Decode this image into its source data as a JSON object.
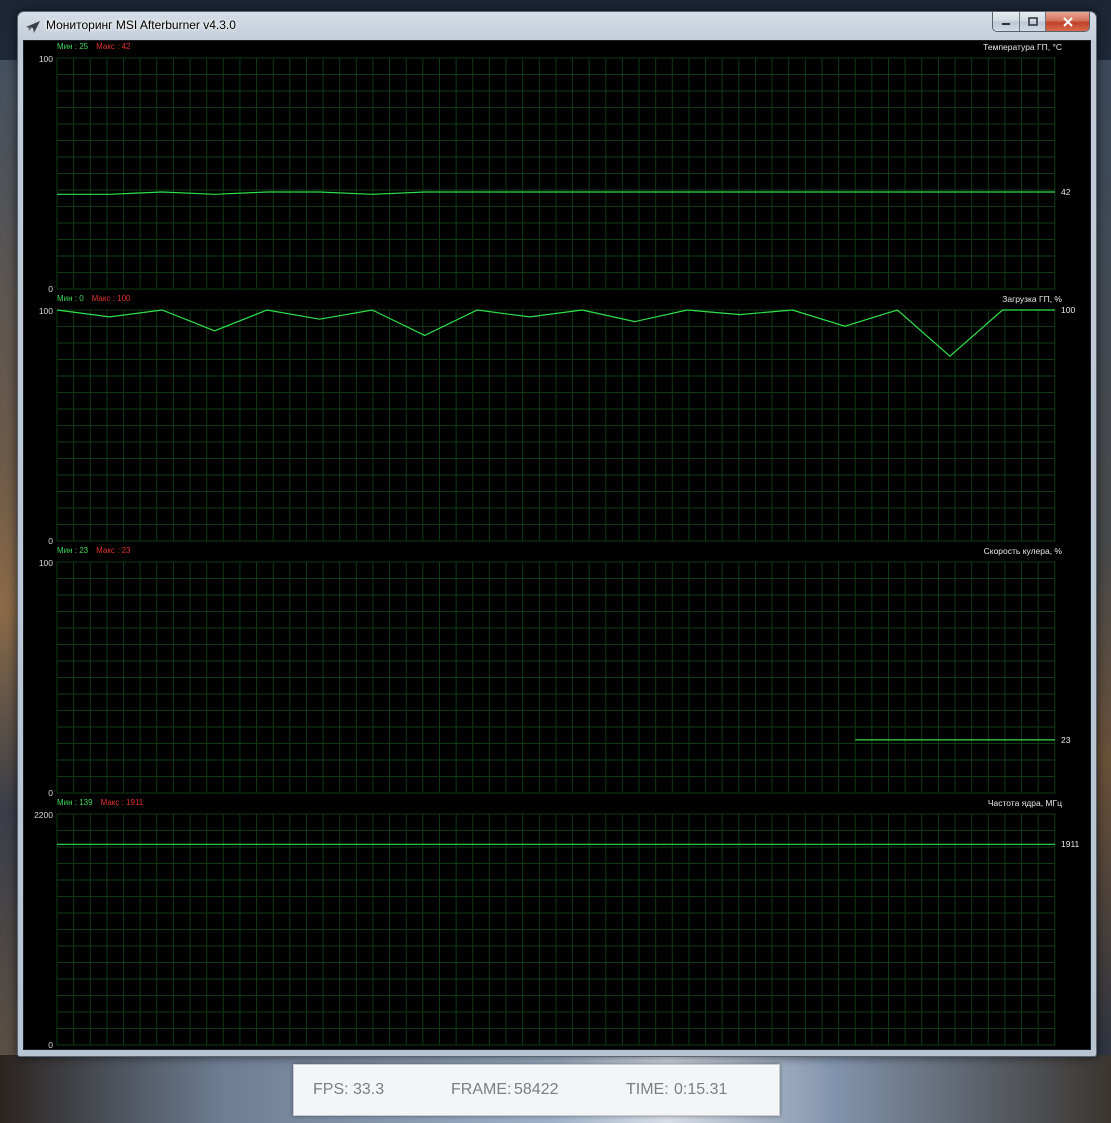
{
  "window": {
    "title": "Мониторинг MSI Afterburner v4.3.0",
    "icon": "afterburner-plane-icon",
    "controls": {
      "minimize": "minimize-icon",
      "maximize": "maximize-icon",
      "close": "close-icon"
    }
  },
  "panels": [
    {
      "id": "gpu-temp",
      "title": "Температура ГП, °C",
      "min_label": "Мин : 25",
      "max_label": "Макс : 42",
      "y_max_label": "100",
      "y_min_label": "0",
      "current_label": "42"
    },
    {
      "id": "gpu-load",
      "title": "Загрузка ГП, %",
      "min_label": "Мин : 0",
      "max_label": "Макс : 100",
      "y_max_label": "100",
      "y_min_label": "0",
      "current_label": "100"
    },
    {
      "id": "fan-speed",
      "title": "Скорость кулера, %",
      "min_label": "Мин : 23",
      "max_label": "Макс : 23",
      "y_max_label": "100",
      "y_min_label": "0",
      "current_label": "23"
    },
    {
      "id": "core-clock",
      "title": "Частота ядра, МГц",
      "min_label": "Мин : 139",
      "max_label": "Макс : 1911",
      "y_max_label": "2200",
      "y_min_label": "0",
      "current_label": "1911"
    }
  ],
  "chart_data": [
    {
      "type": "line",
      "title": "Температура ГП, °C",
      "ylim": [
        0,
        100
      ],
      "grid": true,
      "series": [
        {
          "values": [
            41,
            41,
            42,
            41,
            42,
            42,
            41,
            42,
            42,
            42,
            42,
            42,
            42,
            42,
            42,
            42,
            42,
            42,
            42,
            42
          ]
        }
      ]
    },
    {
      "type": "line",
      "title": "Загрузка ГП, %",
      "ylim": [
        0,
        100
      ],
      "grid": true,
      "series": [
        {
          "values": [
            100,
            97,
            100,
            91,
            100,
            96,
            100,
            89,
            100,
            97,
            100,
            95,
            100,
            98,
            100,
            93,
            100,
            80,
            100,
            100
          ]
        }
      ]
    },
    {
      "type": "line",
      "title": "Скорость кулера, %",
      "ylim": [
        0,
        100
      ],
      "grid": true,
      "series": [
        {
          "values": [
            23,
            23
          ]
        }
      ],
      "x_start_fraction": 0.8
    },
    {
      "type": "line",
      "title": "Частота ядра, МГц",
      "ylim": [
        0,
        2200
      ],
      "grid": true,
      "series": [
        {
          "values": [
            1911,
            1911
          ]
        }
      ]
    }
  ],
  "overlay": {
    "fps_label": "FPS:",
    "fps_value": "33.3",
    "frame_label": "FRAME:",
    "frame_value": "58422",
    "time_label": "TIME:",
    "time_value": "0:15.31"
  }
}
